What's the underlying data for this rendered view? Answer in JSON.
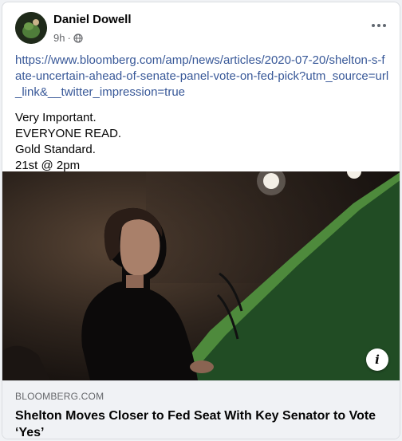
{
  "post": {
    "author": "Daniel Dowell",
    "time": "9h",
    "separator": "·",
    "privacy_icon": "globe-icon",
    "more_icon": "more-horizontal-icon",
    "link": "https://www.bloomberg.com/amp/news/articles/2020-07-20/shelton-s-fate-uncertain-ahead-of-senate-panel-vote-on-fed-pick?utm_source=url_link&__twitter_impression=true",
    "lines": [
      "Very Important.",
      "EVERYONE READ.",
      "Gold Standard.",
      "21st @ 2pm"
    ]
  },
  "preview": {
    "info_label": "i",
    "source": "BLOOMBERG.COM",
    "headline": "Shelton Moves Closer to Fed Seat With Key Senator to Vote ‘Yes’"
  },
  "colors": {
    "link": "#385898",
    "secondary_text": "#65676b",
    "card_background": "#ffffff",
    "preview_background": "#f0f2f5"
  }
}
